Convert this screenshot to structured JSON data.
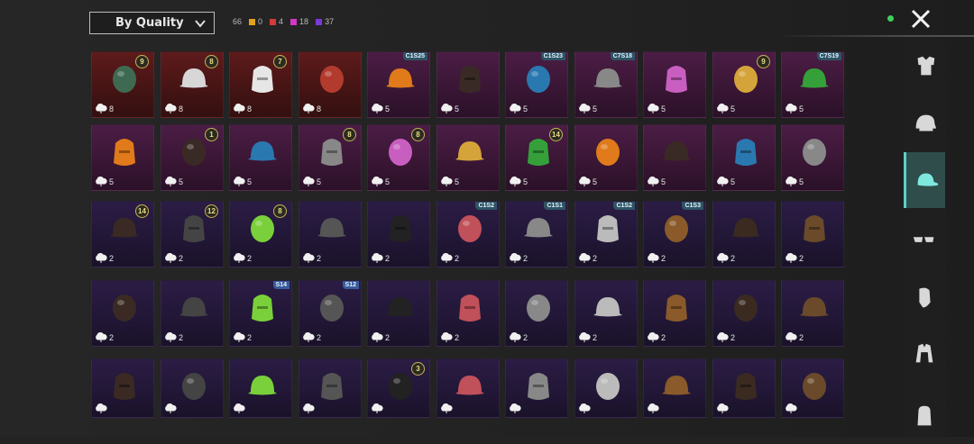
{
  "sort": {
    "label": "By Quality"
  },
  "counts": {
    "total": "66",
    "items": [
      {
        "value": "0",
        "color": "#e2a21c"
      },
      {
        "value": "4",
        "color": "#d33a3a"
      },
      {
        "value": "18",
        "color": "#d437c4"
      },
      {
        "value": "37",
        "color": "#7a3ad8"
      }
    ]
  },
  "rows": [
    [
      {
        "rarity": "red",
        "qty": "8",
        "badge": "9",
        "icon": "zombie-mask-icon"
      },
      {
        "rarity": "red",
        "qty": "8",
        "badge": "8",
        "icon": "white-hair-icon"
      },
      {
        "rarity": "red",
        "qty": "8",
        "badge": "7",
        "icon": "white-hair-long-icon"
      },
      {
        "rarity": "red",
        "qty": "8",
        "badge": "",
        "icon": "red-helmet-icon"
      },
      {
        "rarity": "pink",
        "qty": "5",
        "season": "C1S25",
        "icon": "grey-hair-icon"
      },
      {
        "rarity": "pink",
        "qty": "5",
        "icon": "pink-hair-icon"
      },
      {
        "rarity": "pink",
        "qty": "5",
        "season": "C1S23",
        "icon": "gas-mask-icon"
      },
      {
        "rarity": "pink",
        "qty": "5",
        "season": "C7S18",
        "icon": "green-hair-icon"
      },
      {
        "rarity": "pink",
        "qty": "5",
        "icon": "pumpkin-mask-icon"
      },
      {
        "rarity": "pink",
        "qty": "5",
        "badge": "9",
        "icon": "dark-hair-icon"
      },
      {
        "rarity": "pink",
        "qty": "5",
        "season": "C7S19",
        "icon": "blue-mohawk-icon"
      }
    ],
    [
      {
        "rarity": "pink",
        "qty": "5",
        "icon": "chicken-mask-icon"
      },
      {
        "rarity": "pink",
        "qty": "5",
        "badge": "1",
        "icon": "twin-tail-hair-icon"
      },
      {
        "rarity": "pink",
        "qty": "5",
        "icon": "monster-mask-icon"
      },
      {
        "rarity": "pink",
        "qty": "5",
        "badge": "8",
        "icon": "spiked-helmet-icon"
      },
      {
        "rarity": "pink",
        "qty": "5",
        "badge": "8",
        "icon": "fedora-hat-icon"
      },
      {
        "rarity": "pink",
        "qty": "5",
        "icon": "green-bandana-icon"
      },
      {
        "rarity": "pink",
        "qty": "5",
        "badge": "14",
        "icon": "officer-cap-icon"
      },
      {
        "rarity": "pink",
        "qty": "5",
        "icon": "black-helmet-icon"
      },
      {
        "rarity": "pink",
        "qty": "5",
        "icon": "chef-hat-icon"
      },
      {
        "rarity": "pink",
        "qty": "5",
        "icon": "headband-icon"
      },
      {
        "rarity": "pink",
        "qty": "5",
        "icon": "white-hat-icon"
      }
    ],
    [
      {
        "rarity": "purple",
        "qty": "2",
        "badge": "14",
        "icon": "brown-hair-bow-icon"
      },
      {
        "rarity": "purple",
        "qty": "2",
        "badge": "12",
        "icon": "bunny-ears-icon"
      },
      {
        "rarity": "purple",
        "qty": "2",
        "badge": "8",
        "icon": "skull-hood-icon"
      },
      {
        "rarity": "purple",
        "qty": "2",
        "icon": "painted-cap-icon"
      },
      {
        "rarity": "purple",
        "qty": "2",
        "icon": "black-cap-icon"
      },
      {
        "rarity": "purple",
        "qty": "2",
        "season": "C1S2",
        "icon": "striped-beanie-icon"
      },
      {
        "rarity": "purple",
        "qty": "2",
        "season": "C1S1",
        "icon": "grey-hair-short-icon"
      },
      {
        "rarity": "purple",
        "qty": "2",
        "season": "C1S2",
        "icon": "respirator-icon"
      },
      {
        "rarity": "purple",
        "qty": "2",
        "season": "C1S3",
        "icon": "camel-mask-icon"
      },
      {
        "rarity": "purple",
        "qty": "2",
        "icon": "tribal-mask-icon"
      },
      {
        "rarity": "purple",
        "qty": "2",
        "icon": "brown-hair-icon"
      }
    ],
    [
      {
        "rarity": "purple",
        "qty": "2",
        "icon": "bob-hair-icon"
      },
      {
        "rarity": "purple",
        "qty": "2",
        "icon": "yellow-beanie-icon"
      },
      {
        "rarity": "purple",
        "qty": "2",
        "season": "S14",
        "icon": "knight-helmet-icon"
      },
      {
        "rarity": "purple",
        "qty": "2",
        "season": "S12",
        "icon": "visor-helmet-icon"
      },
      {
        "rarity": "purple",
        "qty": "2",
        "icon": "knit-cap-icon"
      },
      {
        "rarity": "purple",
        "qty": "2",
        "icon": "dark-cap-icon"
      },
      {
        "rarity": "purple",
        "qty": "2",
        "icon": "grey-beanie-icon"
      },
      {
        "rarity": "purple",
        "qty": "2",
        "icon": "blue-beanie-icon"
      },
      {
        "rarity": "purple",
        "qty": "2",
        "icon": "silver-mask-icon"
      },
      {
        "rarity": "purple",
        "qty": "2",
        "icon": "shark-hat-icon"
      },
      {
        "rarity": "purple",
        "qty": "2",
        "icon": "red-beret-icon"
      }
    ],
    [
      {
        "rarity": "purple",
        "qty": "",
        "icon": "top-hat-icon"
      },
      {
        "rarity": "purple",
        "qty": "",
        "icon": "red-fedora-icon"
      },
      {
        "rarity": "purple",
        "qty": "",
        "icon": "shark-head-icon"
      },
      {
        "rarity": "purple",
        "qty": "",
        "icon": "red-bucket-hat-icon"
      },
      {
        "rarity": "purple",
        "qty": "",
        "badge": "3",
        "icon": "black-fedora-icon"
      },
      {
        "rarity": "purple",
        "qty": "",
        "icon": "cake-hat-icon"
      },
      {
        "rarity": "purple",
        "qty": "",
        "icon": "burger-hat-icon"
      },
      {
        "rarity": "purple",
        "qty": "",
        "icon": "mirror-headband-icon"
      },
      {
        "rarity": "purple",
        "qty": "",
        "icon": "navy-cap-icon"
      },
      {
        "rarity": "purple",
        "qty": "",
        "icon": "teal-cap-icon"
      },
      {
        "rarity": "purple",
        "qty": "",
        "icon": "brown-fedora-icon"
      }
    ]
  ],
  "sidebar": [
    {
      "name": "outfit",
      "icon": "outfit-icon",
      "active": false
    },
    {
      "name": "headwear",
      "icon": "helmet-icon",
      "active": false
    },
    {
      "name": "hats",
      "icon": "cap-icon",
      "active": true
    },
    {
      "name": "eyewear",
      "icon": "glasses-icon",
      "active": false
    },
    {
      "name": "mask",
      "icon": "mask-icon",
      "active": false
    },
    {
      "name": "top",
      "icon": "jacket-icon",
      "active": false
    },
    {
      "name": "backpack",
      "icon": "backpack-icon",
      "active": false
    }
  ]
}
